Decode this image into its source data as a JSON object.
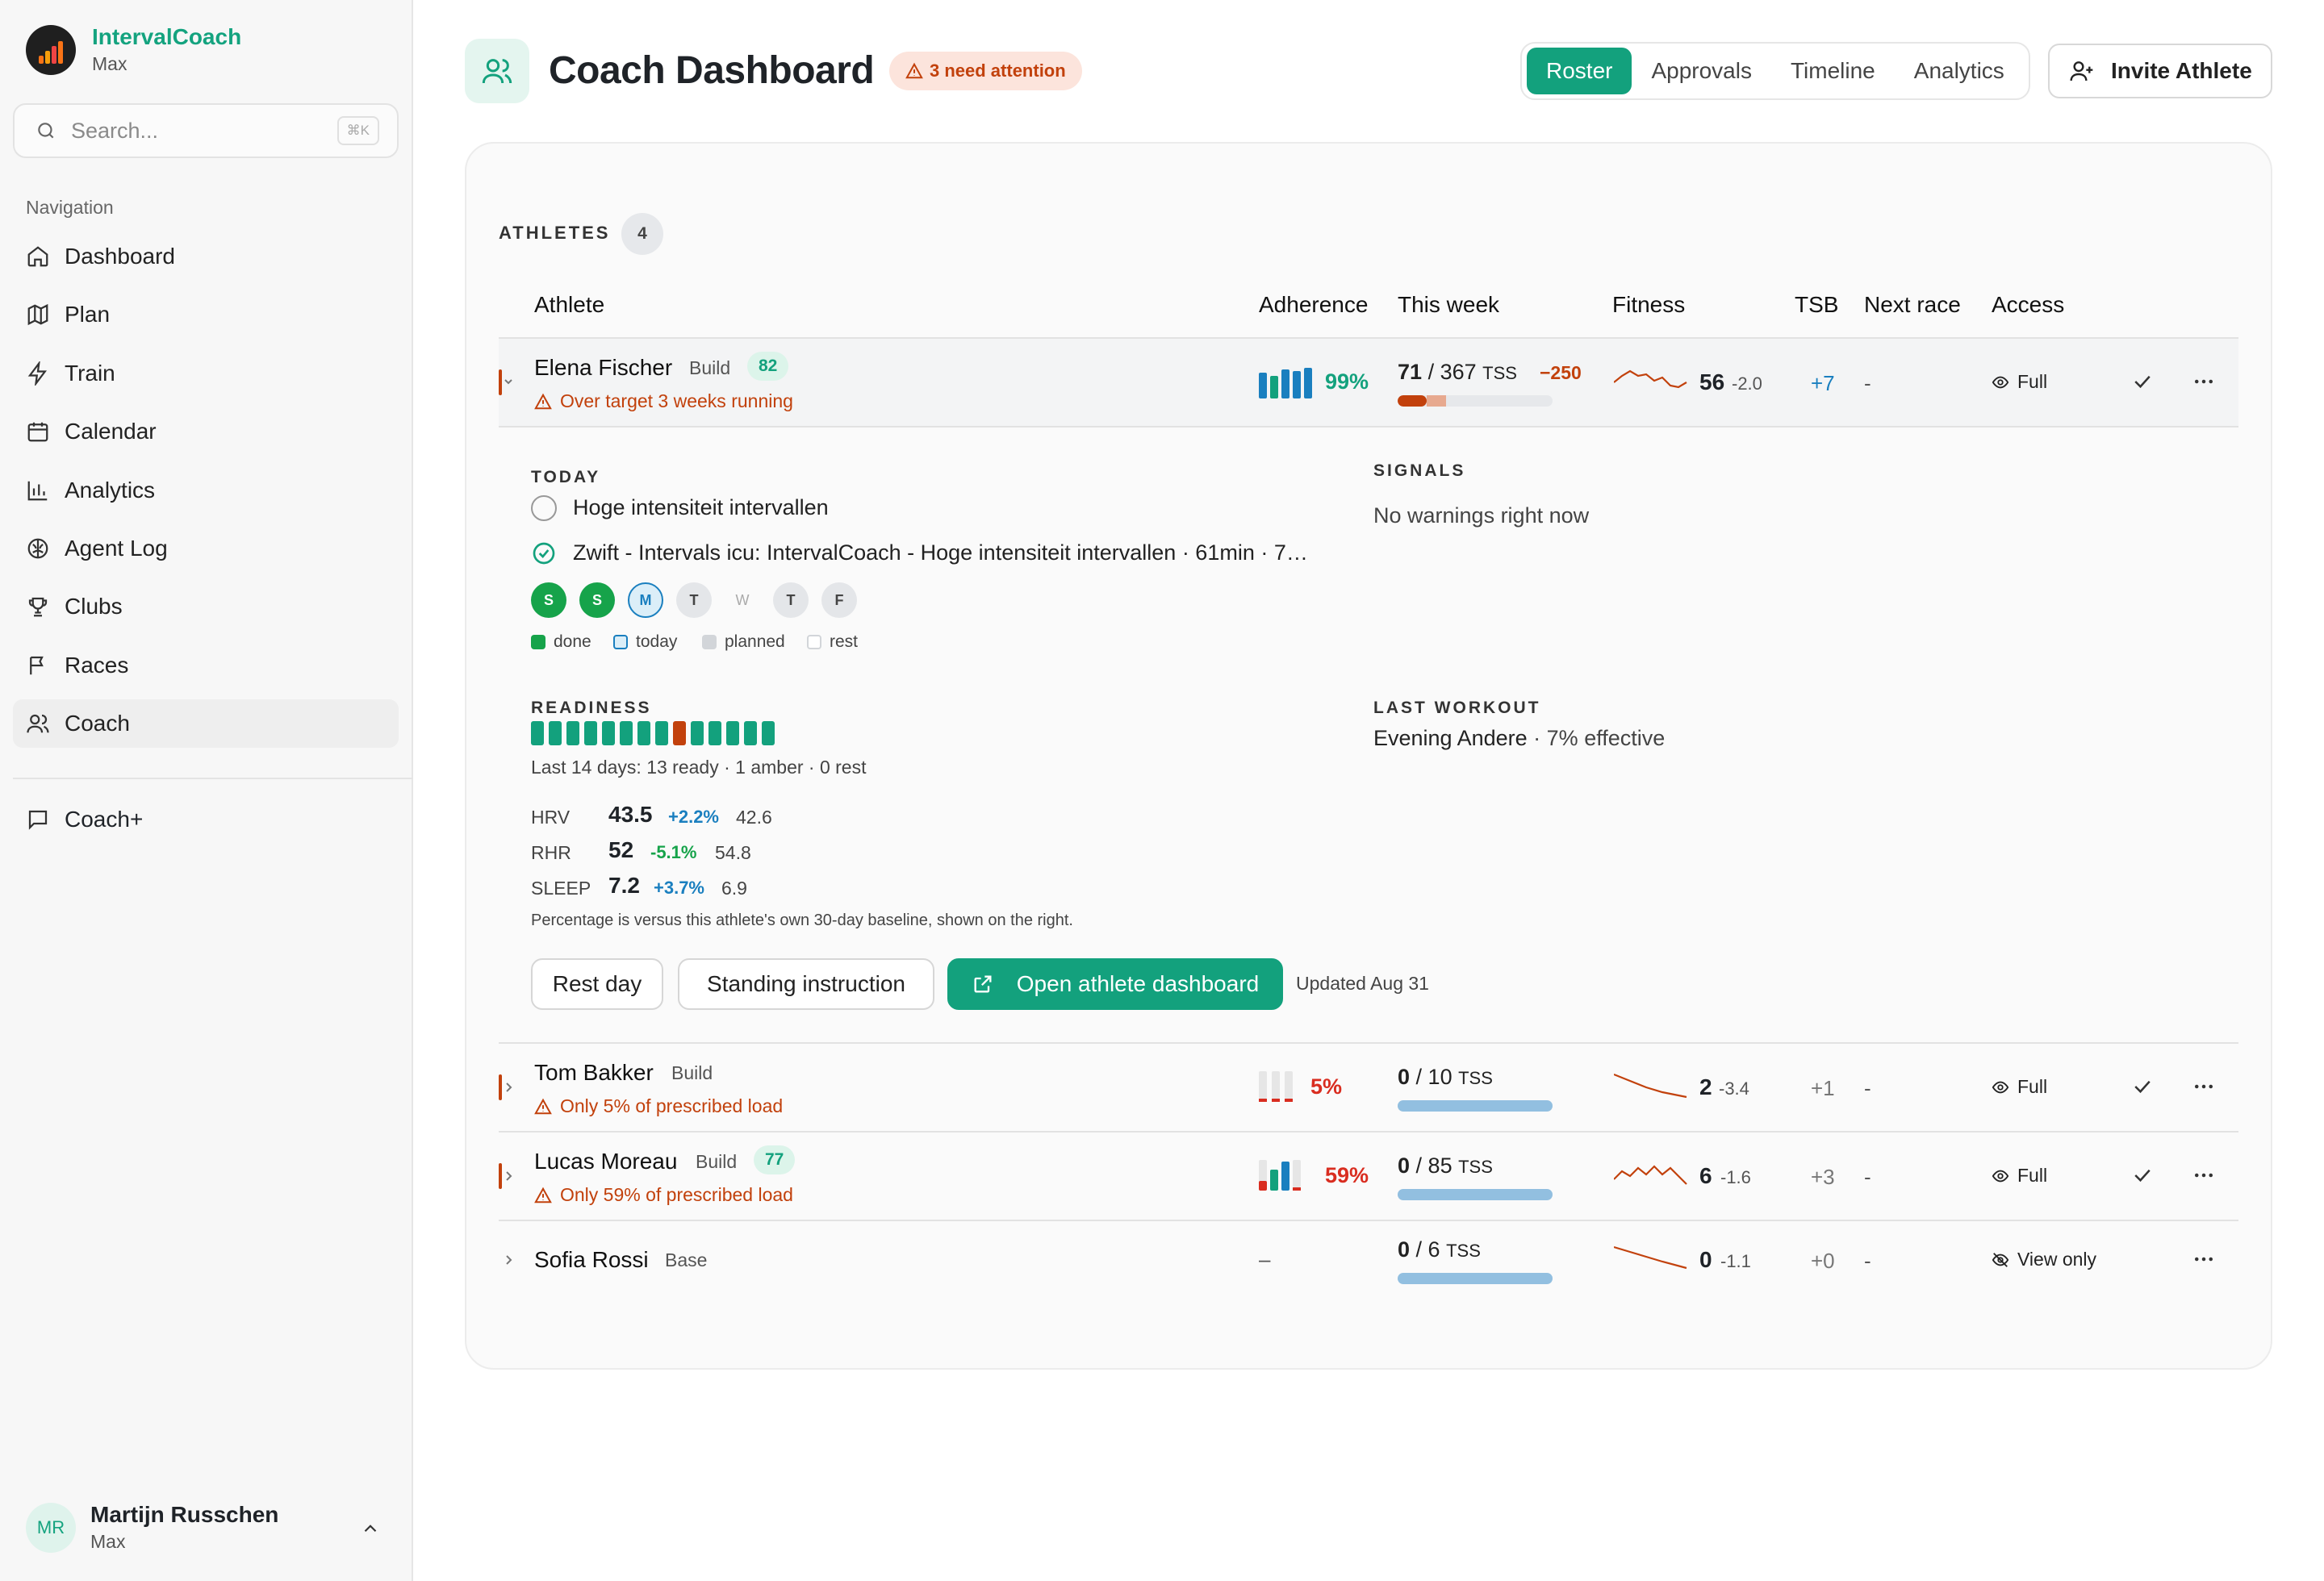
{
  "app": {
    "name": "IntervalCoach",
    "sub": "Max"
  },
  "search": {
    "placeholder": "Search...",
    "shortcut": "⌘K"
  },
  "nav": {
    "heading": "Navigation",
    "items": [
      {
        "label": "Dashboard",
        "icon": "home-icon"
      },
      {
        "label": "Plan",
        "icon": "map-icon"
      },
      {
        "label": "Train",
        "icon": "zap-icon"
      },
      {
        "label": "Calendar",
        "icon": "calendar-icon"
      },
      {
        "label": "Analytics",
        "icon": "bar-chart-icon"
      },
      {
        "label": "Agent Log",
        "icon": "brain-icon"
      },
      {
        "label": "Clubs",
        "icon": "trophy-icon"
      },
      {
        "label": "Races",
        "icon": "flag-icon"
      },
      {
        "label": "Coach",
        "icon": "users-icon",
        "active": true
      }
    ],
    "extra": {
      "label": "Coach+",
      "icon": "message-icon"
    }
  },
  "user": {
    "initials": "MR",
    "name": "Martijn Russchen",
    "sub": "Max"
  },
  "header": {
    "title": "Coach Dashboard",
    "attention": "3 need attention",
    "tabs": [
      "Roster",
      "Approvals",
      "Timeline",
      "Analytics"
    ],
    "active_tab": "Roster",
    "invite_label": "Invite Athlete"
  },
  "roster": {
    "section_label": "ATHLETES",
    "count": "4",
    "columns": [
      "Athlete",
      "Adherence",
      "This week",
      "Fitness",
      "TSB",
      "Next race",
      "Access"
    ],
    "rows": [
      {
        "name": "Elena Fischer",
        "phase": "Build",
        "score": "82",
        "warning": "Over target 3 weeks running",
        "adherence": "99%",
        "adherence_fraction": 0.99,
        "week_done": "71",
        "week_sep": "/ 367",
        "week_unit": "TSS",
        "week_delta": "−250",
        "week_fraction": 0.19,
        "fitness": "56",
        "fitness_delta": "-2.0",
        "tsb": "+7",
        "next_race": "-",
        "access": "Full",
        "expanded": true
      },
      {
        "name": "Tom Bakker",
        "phase": "Build",
        "score": "",
        "warning": "Only 5% of prescribed load",
        "adherence": "5%",
        "adherence_fraction": 0.05,
        "week_done": "0",
        "week_sep": "/ 10",
        "week_unit": "TSS",
        "week_delta": "",
        "week_fraction": 0,
        "fitness": "2",
        "fitness_delta": "-3.4",
        "tsb": "+1",
        "next_race": "-",
        "access": "Full"
      },
      {
        "name": "Lucas Moreau",
        "phase": "Build",
        "score": "77",
        "warning": "Only 59% of prescribed load",
        "adherence": "59%",
        "adherence_fraction": 0.59,
        "week_done": "0",
        "week_sep": "/ 85",
        "week_unit": "TSS",
        "week_delta": "",
        "week_fraction": 0,
        "fitness": "6",
        "fitness_delta": "-1.6",
        "tsb": "+3",
        "next_race": "-",
        "access": "Full"
      },
      {
        "name": "Sofia Rossi",
        "phase": "Base",
        "score": "",
        "warning": "",
        "adherence": "–",
        "adherence_fraction": null,
        "week_done": "0",
        "week_sep": "/ 6",
        "week_unit": "TSS",
        "week_delta": "",
        "week_fraction": 0,
        "fitness": "0",
        "fitness_delta": "-1.1",
        "tsb": "+0",
        "next_race": "-",
        "access": "View only"
      }
    ]
  },
  "detail": {
    "today_label": "TODAY",
    "today_items": [
      {
        "text": "Hoge intensiteit intervallen",
        "status": "pending"
      },
      {
        "text": "Zwift - Intervals icu: IntervalCoach - Hoge intensiteit intervallen · 61min · 7…",
        "status": "done"
      }
    ],
    "week_days": [
      {
        "letter": "S",
        "state": "done"
      },
      {
        "letter": "S",
        "state": "done"
      },
      {
        "letter": "M",
        "state": "today"
      },
      {
        "letter": "T",
        "state": "planned"
      },
      {
        "letter": "W",
        "state": "rest"
      },
      {
        "letter": "T",
        "state": "planned"
      },
      {
        "letter": "F",
        "state": "planned"
      }
    ],
    "legend": [
      "done",
      "today",
      "planned",
      "rest"
    ],
    "signals_label": "SIGNALS",
    "signals_text": "No warnings right now",
    "readiness_label": "READINESS",
    "readiness_days": [
      "ready",
      "ready",
      "ready",
      "ready",
      "ready",
      "ready",
      "ready",
      "ready",
      "amber",
      "ready",
      "ready",
      "ready",
      "ready",
      "ready"
    ],
    "readiness_summary": "Last 14 days: 13 ready · 1 amber · 0 rest",
    "metrics": [
      {
        "label": "HRV",
        "value": "43.5",
        "change": "+2.2%",
        "baseline": "42.6"
      },
      {
        "label": "RHR",
        "value": "52",
        "change": "-5.1%",
        "baseline": "54.8"
      },
      {
        "label": "SLEEP",
        "value": "7.2",
        "change": "+3.7%",
        "baseline": "6.9"
      }
    ],
    "metrics_note": "Percentage is versus this athlete's own 30-day baseline, shown on the right.",
    "last_workout_label": "LAST WORKOUT",
    "last_workout_name": "Evening Andere",
    "last_workout_detail": "· 7% effective",
    "buttons": {
      "rest": "Rest day",
      "standing": "Standing instruction",
      "open": "Open athlete dashboard"
    },
    "updated": "Updated Aug 31"
  },
  "colors": {
    "accent": "#13a17d",
    "warning": "#c2410c",
    "progress": "#92bfe0",
    "adherence_bar": "#1a7fbf",
    "danger": "#d92d20"
  }
}
